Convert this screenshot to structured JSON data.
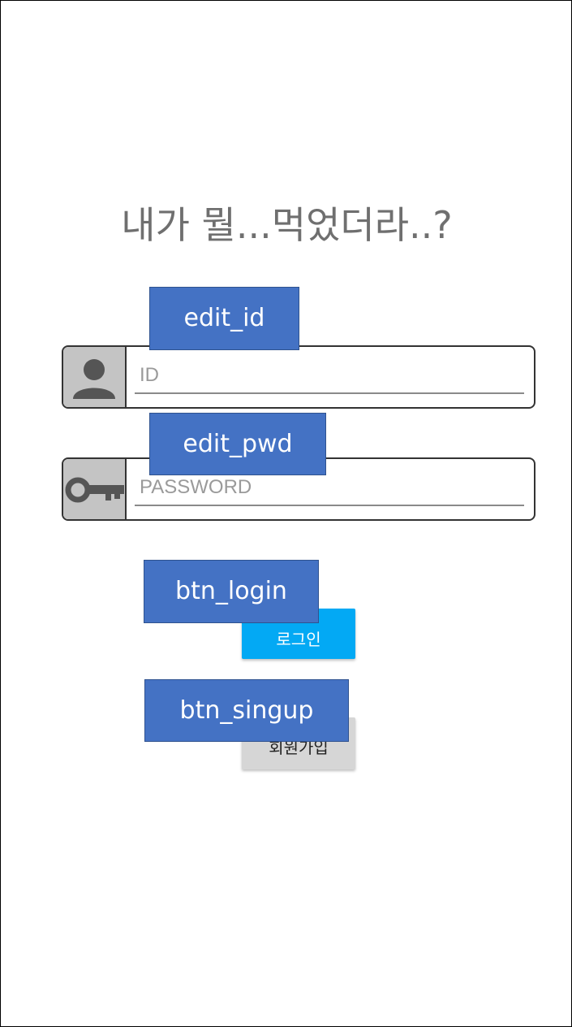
{
  "app": {
    "title": "내가 뭘...먹었더라..?"
  },
  "fields": {
    "id": {
      "placeholder": "ID",
      "value": "",
      "icon": "person-icon"
    },
    "password": {
      "placeholder": "PASSWORD",
      "value": "",
      "icon": "key-icon"
    }
  },
  "buttons": {
    "login_label": "로그인",
    "signup_label": "회원가입"
  },
  "annotations": {
    "edit_id": "edit_id",
    "edit_pwd": "edit_pwd",
    "btn_login": "btn_login",
    "btn_signup": "btn_singup"
  },
  "colors": {
    "login_button": "#03a9f4",
    "signup_button": "#d6d6d6",
    "annotation_tag": "#4472c4",
    "title_text": "#6f6f6f"
  }
}
